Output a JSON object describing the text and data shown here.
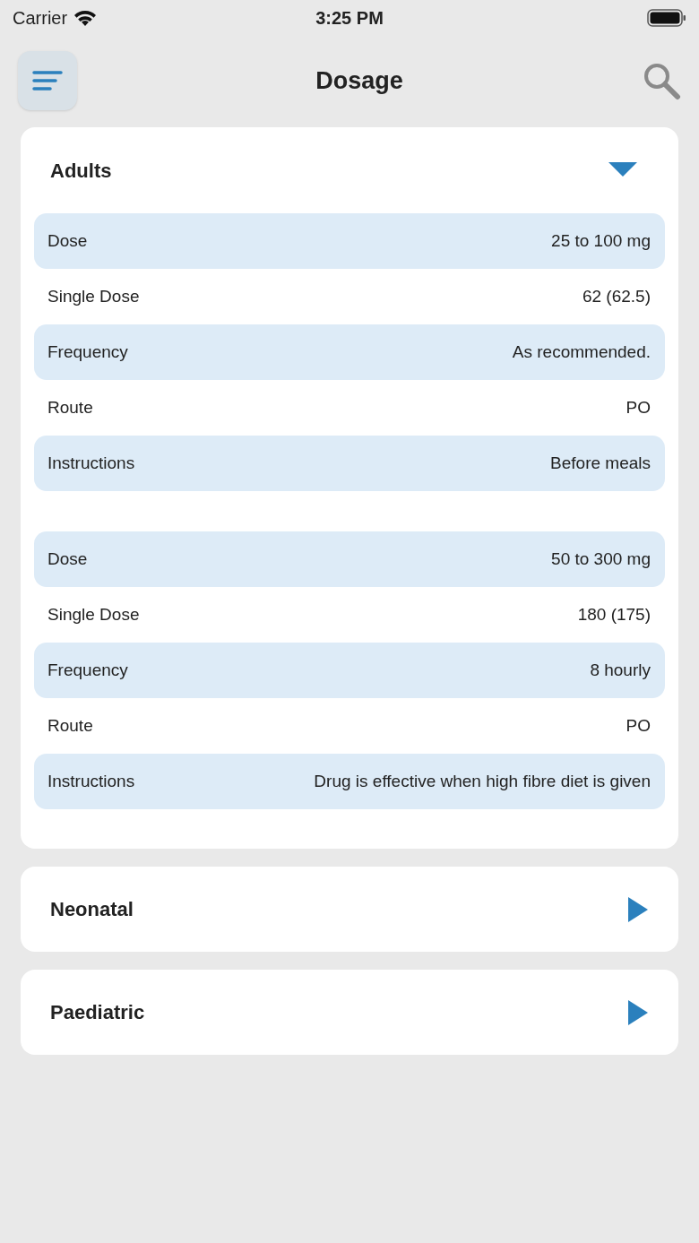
{
  "status_bar": {
    "carrier": "Carrier",
    "time": "3:25 PM"
  },
  "header": {
    "title": "Dosage"
  },
  "sections": [
    {
      "title": "Adults",
      "expanded": true,
      "groups": [
        [
          {
            "label": "Dose",
            "value": "25 to 100 mg"
          },
          {
            "label": "Single Dose",
            "value": "62 (62.5)"
          },
          {
            "label": "Frequency",
            "value": "As recommended."
          },
          {
            "label": "Route",
            "value": "PO"
          },
          {
            "label": "Instructions",
            "value": "Before meals"
          }
        ],
        [
          {
            "label": "Dose",
            "value": "50 to 300 mg"
          },
          {
            "label": "Single Dose",
            "value": "180 (175)"
          },
          {
            "label": "Frequency",
            "value": "8 hourly"
          },
          {
            "label": "Route",
            "value": "PO"
          },
          {
            "label": "Instructions",
            "value": "Drug is effective when high fibre diet is given"
          }
        ]
      ]
    },
    {
      "title": "Neonatal",
      "expanded": false
    },
    {
      "title": "Paediatric",
      "expanded": false
    }
  ]
}
